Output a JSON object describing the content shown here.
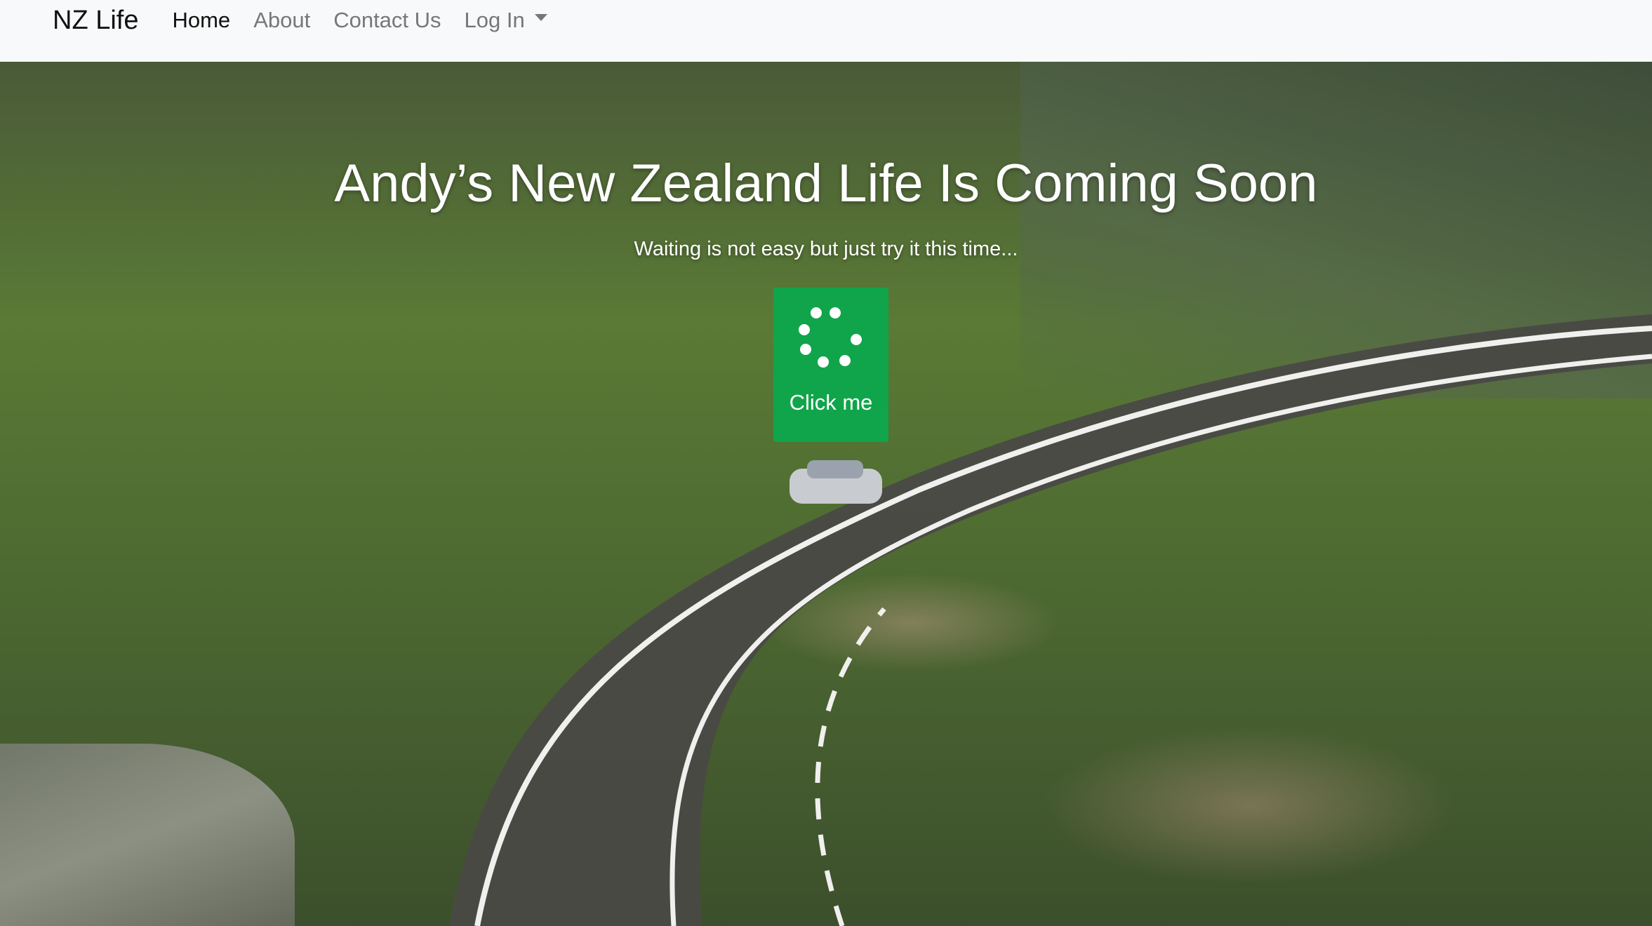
{
  "navbar": {
    "brand": "NZ Life",
    "links": [
      {
        "label": "Home",
        "active": true
      },
      {
        "label": "About",
        "active": false
      },
      {
        "label": "Contact Us",
        "active": false
      }
    ],
    "dropdown": {
      "label": "Log In"
    }
  },
  "hero": {
    "title": "Andy’s New Zealand Life Is Coming Soon",
    "subtitle": "Waiting is not easy but just try it this time...",
    "button": {
      "label": "Click me",
      "icon": "spinner-icon",
      "color": "#10a54a"
    },
    "background_image": "aerial-road-sheep-mountain-photo"
  }
}
